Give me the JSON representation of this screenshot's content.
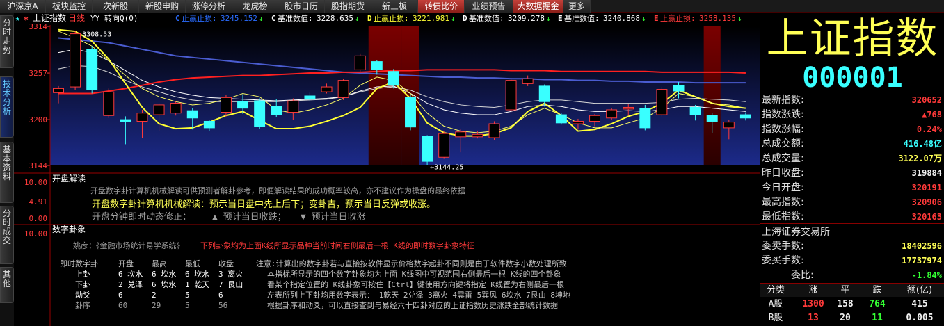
{
  "topnav": {
    "tabs": [
      {
        "label": "沪深京A",
        "highlight": false
      },
      {
        "label": "板块监控",
        "highlight": false
      },
      {
        "label": "次新股",
        "highlight": false
      },
      {
        "label": "新股申购",
        "highlight": false
      },
      {
        "label": "涨停分析",
        "highlight": false
      },
      {
        "label": "龙虎榜",
        "highlight": false
      },
      {
        "label": "股市日历",
        "highlight": false
      },
      {
        "label": "股指期货",
        "highlight": false
      },
      {
        "label": "新三板",
        "highlight": false
      },
      {
        "label": "转债比价",
        "highlight": true
      },
      {
        "label": "业绩预告",
        "highlight": false
      },
      {
        "label": "大数据掘金",
        "highlight": true
      },
      {
        "label": "更多",
        "highlight": false
      }
    ]
  },
  "lefttabs": [
    {
      "label": "分时走势",
      "active": false
    },
    {
      "label": "技术分析",
      "active": true
    },
    {
      "label": "基本资料",
      "active": false
    },
    {
      "label": "分时成交",
      "active": false
    },
    {
      "label": "其他",
      "active": false
    }
  ],
  "header": {
    "star": "★",
    "gear": "✱",
    "index_name": "上证指数",
    "period": "日线",
    "yy": "YY",
    "mode": "转向Q(0)",
    "items": [
      {
        "prefix": "C",
        "label": "止赢止损:",
        "value": "3245.152",
        "arrow": "↓",
        "color": "#2a6cff"
      },
      {
        "prefix": "C",
        "label": "基准数值:",
        "value": "3228.635",
        "arrow": "↓",
        "color": "#ffffff"
      },
      {
        "prefix": "D",
        "label": "止赢止损:",
        "value": "3221.981",
        "arrow": "↓",
        "color": "#ffff33"
      },
      {
        "prefix": "D",
        "label": "基准数值:",
        "value": "3209.278",
        "arrow": "↓",
        "color": "#ffffff"
      },
      {
        "prefix": "E",
        "label": "基准数值:",
        "value": "3240.868",
        "arrow": "↓",
        "color": "#ffffff"
      },
      {
        "prefix": "E",
        "label": "止赢止损:",
        "value": "3258.135",
        "arrow": "↓",
        "color": "#ff3a3a"
      }
    ]
  },
  "chart_data": {
    "type": "candlestick",
    "ylim": [
      3144,
      3314
    ],
    "yticks": [
      "3314",
      "3257",
      "3200",
      "3144"
    ],
    "high_label": "3308.53",
    "low_label": "←3144.25",
    "candles": [
      {
        "o": 3233,
        "c": 3238,
        "h": 3241,
        "l": 3220
      },
      {
        "o": 3240,
        "c": 3305,
        "h": 3308.53,
        "l": 3236
      },
      {
        "o": 3286,
        "c": 3237,
        "h": 3290,
        "l": 3232
      },
      {
        "o": 3205,
        "c": 3234,
        "h": 3238,
        "l": 3202
      },
      {
        "o": 3200,
        "c": 3198,
        "h": 3204,
        "l": 3170
      },
      {
        "o": 3198,
        "c": 3208,
        "h": 3212,
        "l": 3178
      },
      {
        "o": 3206,
        "c": 3218,
        "h": 3220,
        "l": 3186
      },
      {
        "o": 3208,
        "c": 3220,
        "h": 3222,
        "l": 3205
      },
      {
        "o": 3211,
        "c": 3202,
        "h": 3214,
        "l": 3188
      },
      {
        "o": 3198,
        "c": 3190,
        "h": 3200,
        "l": 3186
      },
      {
        "o": 3209,
        "c": 3227,
        "h": 3230,
        "l": 3204
      },
      {
        "o": 3222,
        "c": 3214,
        "h": 3231,
        "l": 3207
      },
      {
        "o": 3223,
        "c": 3192,
        "h": 3226,
        "l": 3189
      },
      {
        "o": 3216,
        "c": 3206,
        "h": 3225,
        "l": 3203
      },
      {
        "o": 3209,
        "c": 3223,
        "h": 3226,
        "l": 3200
      },
      {
        "o": 3229,
        "c": 3225,
        "h": 3233,
        "l": 3223
      },
      {
        "o": 3234,
        "c": 3240,
        "h": 3244,
        "l": 3232
      },
      {
        "o": 3227,
        "c": 3248,
        "h": 3250,
        "l": 3224
      },
      {
        "o": 3261,
        "c": 3278,
        "h": 3281,
        "l": 3258
      },
      {
        "o": 3271,
        "c": 3261,
        "h": 3273,
        "l": 3255
      },
      {
        "o": 3259,
        "c": 3242,
        "h": 3262,
        "l": 3238
      },
      {
        "o": 3227,
        "c": 3191,
        "h": 3230,
        "l": 3187
      },
      {
        "o": 3180,
        "c": 3149,
        "h": 3181,
        "l": 3144.25
      },
      {
        "o": 3154,
        "c": 3183,
        "h": 3186,
        "l": 3152
      },
      {
        "o": 3179,
        "c": 3185,
        "h": 3189,
        "l": 3160
      },
      {
        "o": 3179,
        "c": 3182,
        "h": 3186,
        "l": 3177
      },
      {
        "o": 3178,
        "c": 3195,
        "h": 3198,
        "l": 3175
      },
      {
        "o": 3212,
        "c": 3248,
        "h": 3251,
        "l": 3208
      },
      {
        "o": 3244,
        "c": 3250,
        "h": 3254,
        "l": 3241
      },
      {
        "o": 3241,
        "c": 3222,
        "h": 3243,
        "l": 3216
      },
      {
        "o": 3206,
        "c": 3196,
        "h": 3208,
        "l": 3194
      },
      {
        "o": 3195,
        "c": 3198,
        "h": 3201,
        "l": 3188
      },
      {
        "o": 3198,
        "c": 3205,
        "h": 3207,
        "l": 3192
      },
      {
        "o": 3202,
        "c": 3212,
        "h": 3214,
        "l": 3200
      },
      {
        "o": 3213,
        "c": 3215,
        "h": 3219,
        "l": 3205
      },
      {
        "o": 3214,
        "c": 3190,
        "h": 3218,
        "l": 3187
      },
      {
        "o": 3206,
        "c": 3237,
        "h": 3240,
        "l": 3204
      },
      {
        "o": 3242,
        "c": 3235,
        "h": 3246,
        "l": 3226
      },
      {
        "o": 3215,
        "c": 3206,
        "h": 3218,
        "l": 3199
      },
      {
        "o": 3205,
        "c": 3198,
        "h": 3208,
        "l": 3184
      },
      {
        "o": 3190,
        "c": 3197,
        "h": 3200,
        "l": 3176
      },
      {
        "o": 3206,
        "c": 3202,
        "h": 3209,
        "l": 3199
      }
    ],
    "ma_red": [
      3232,
      3232,
      3232,
      3235,
      3238,
      3242,
      3246,
      3249,
      3251,
      3252,
      3253,
      3254,
      3254,
      3255,
      3256,
      3257,
      3257,
      3258,
      3258,
      3259,
      3260,
      3260,
      3261,
      3261,
      3261,
      3261,
      3261,
      3260,
      3260,
      3260,
      3259,
      3259,
      3259,
      3259,
      3259,
      3259,
      3258,
      3258,
      3258,
      3258,
      3258,
      3257
    ],
    "ma_blue": [
      3300,
      3298,
      3296,
      3294,
      3290,
      3286,
      3282,
      3278,
      3276,
      3274,
      3272,
      3270,
      3268,
      3266,
      3264,
      3262,
      3260,
      3258,
      3257,
      3256,
      3255,
      3254,
      3253,
      3252,
      3252,
      3251,
      3251,
      3250,
      3250,
      3249,
      3249,
      3248,
      3248,
      3247,
      3247,
      3246,
      3246,
      3246,
      3245,
      3245,
      3245,
      3245
    ],
    "ma_white1": [
      3282,
      3286,
      3282,
      3272,
      3260,
      3248,
      3240,
      3234,
      3230,
      3227,
      3226,
      3225,
      3224,
      3223,
      3224,
      3225,
      3226,
      3228,
      3235,
      3240,
      3241,
      3232,
      3220,
      3212,
      3208,
      3206,
      3206,
      3210,
      3216,
      3218,
      3216,
      3212,
      3210,
      3210,
      3211,
      3210,
      3212,
      3216,
      3216,
      3214,
      3212,
      3210
    ],
    "ma_white2": [
      3262,
      3266,
      3265,
      3258,
      3248,
      3240,
      3234,
      3228,
      3224,
      3222,
      3222,
      3222,
      3222,
      3222,
      3223,
      3224,
      3225,
      3228,
      3234,
      3238,
      3240,
      3236,
      3228,
      3222,
      3218,
      3216,
      3215,
      3218,
      3222,
      3224,
      3224,
      3222,
      3220,
      3220,
      3220,
      3220,
      3221,
      3225,
      3226,
      3225,
      3224,
      3222
    ],
    "ma_yellow": [
      3308,
      3300,
      3290,
      3272,
      3254,
      3238,
      3228,
      3222,
      3218,
      3220,
      3225,
      3232,
      3228,
      3212,
      3208,
      3212,
      3218,
      3226,
      3242,
      3252,
      3248,
      3232,
      3208,
      3192,
      3186,
      3184,
      3186,
      3192,
      3206,
      3214,
      3206,
      3196,
      3190,
      3190,
      3196,
      3202,
      3214,
      3232,
      3228,
      3220,
      3218,
      3214
    ],
    "ma_yellow2": [
      3310,
      3308,
      3296,
      3274,
      3244,
      3215,
      3195,
      3189,
      3190,
      3197,
      3205,
      3210,
      3199,
      3189,
      3189,
      3192,
      3198,
      3205,
      3215,
      3238,
      3246,
      3226,
      3196,
      3184,
      3180,
      3180,
      3183,
      3190,
      3210,
      3220,
      3205,
      3186,
      3188,
      3195,
      3204,
      3210,
      3220,
      3236,
      3228,
      3220,
      3216,
      3214
    ],
    "red_bands": [
      19,
      20,
      21,
      39
    ]
  },
  "panel2": {
    "title": "开盘解读",
    "yticks": [
      "10.00",
      "4.91",
      "0.00"
    ],
    "line1": "开盘数字卦计算机机械解读可供预测者解卦参考，即便解读结果的成功概率较高，亦不建议作为操盘的最终依据",
    "line2": "开盘数字卦计算机机械解读：预示当日盘中先上后下；变卦吉，预示当日反弹或收涨。",
    "line3_a": "开盘分钟即时动态修正：",
    "line3_b": "▲ 预计当日收跌；",
    "line3_c": "▼ 预计当日收涨"
  },
  "panel3": {
    "title": "数字卦象",
    "ytick": "10.00",
    "src_a": "姚彦：《金融市场统计易学系统》",
    "src_b": "下列卦象均为上面K线所显示品种当前时间右侧最后一根 K线的即时数字卦象特征",
    "table": {
      "headers": [
        "即时数字卦",
        "开盘",
        "最高",
        "最低",
        "收盘"
      ],
      "rows": [
        [
          "上卦",
          "6 坎水",
          "6 坎水",
          "6 坎水",
          "3 离火"
        ],
        [
          "下卦",
          "2 兑泽",
          "6 坎水",
          "1 乾天",
          "7 艮山"
        ],
        [
          "动爻",
          "6",
          "2",
          "5",
          "6"
        ],
        [
          "卦序",
          "60",
          "29",
          "5",
          "56"
        ]
      ]
    },
    "note": [
      "注意:计算出的数字卦若与直接按软件显示价格数字起卦不同则是由于软件数字小数处理所致",
      "本指标所显示的四个数字卦象均为上面 K线图中可视范围右侧最后一根 K线的四个卦象",
      "看某个指定位置的 K线卦象可按住【Ctrl】键使用方向键将指定 K线置为右侧最后一根",
      "左表所列上下卦均用数字表示： 1乾天 2兑泽 3离火 4震雷 5巽风 6坎水 7艮山 8坤地",
      "根据卦序和动爻，可以直接查到与易经六十四卦对应的上证指数历史涨跌全部统计数据"
    ]
  },
  "right": {
    "title": "上证指数",
    "code": "000001",
    "quotes": [
      {
        "label": "最新指数:",
        "value": "320652",
        "color": "red"
      },
      {
        "label": "指数涨跌:",
        "value": "▲768",
        "color": "red"
      },
      {
        "label": "指数涨幅:",
        "value": "0.24%",
        "color": "red"
      },
      {
        "label": "总成交额:",
        "value": "416.48亿",
        "color": "cyan"
      },
      {
        "label": "总成交量:",
        "value": "3122.07万",
        "color": "yellow"
      },
      {
        "label": "昨日收盘:",
        "value": "319884",
        "color": "white"
      },
      {
        "label": "今日开盘:",
        "value": "320191",
        "color": "red"
      },
      {
        "label": "最高指数:",
        "value": "320906",
        "color": "red"
      },
      {
        "label": "最低指数:",
        "value": "320163",
        "color": "red"
      }
    ],
    "exchange": "上海证券交易所",
    "quotes2": [
      {
        "label": "委卖手数:",
        "value": "18402596",
        "color": "yellow"
      },
      {
        "label": "委买手数:",
        "value": "17737974",
        "color": "yellow"
      },
      {
        "label": "委比:",
        "value": "-1.84%",
        "color": "green"
      }
    ],
    "table": {
      "headers": [
        "分类",
        "涨",
        "平",
        "跌",
        "额(亿)"
      ],
      "rows": [
        {
          "cells": [
            "A股",
            "1300",
            "158",
            "764",
            "415"
          ]
        },
        {
          "cells": [
            "B股",
            "13",
            "20",
            "11",
            "0.005"
          ]
        }
      ]
    }
  }
}
